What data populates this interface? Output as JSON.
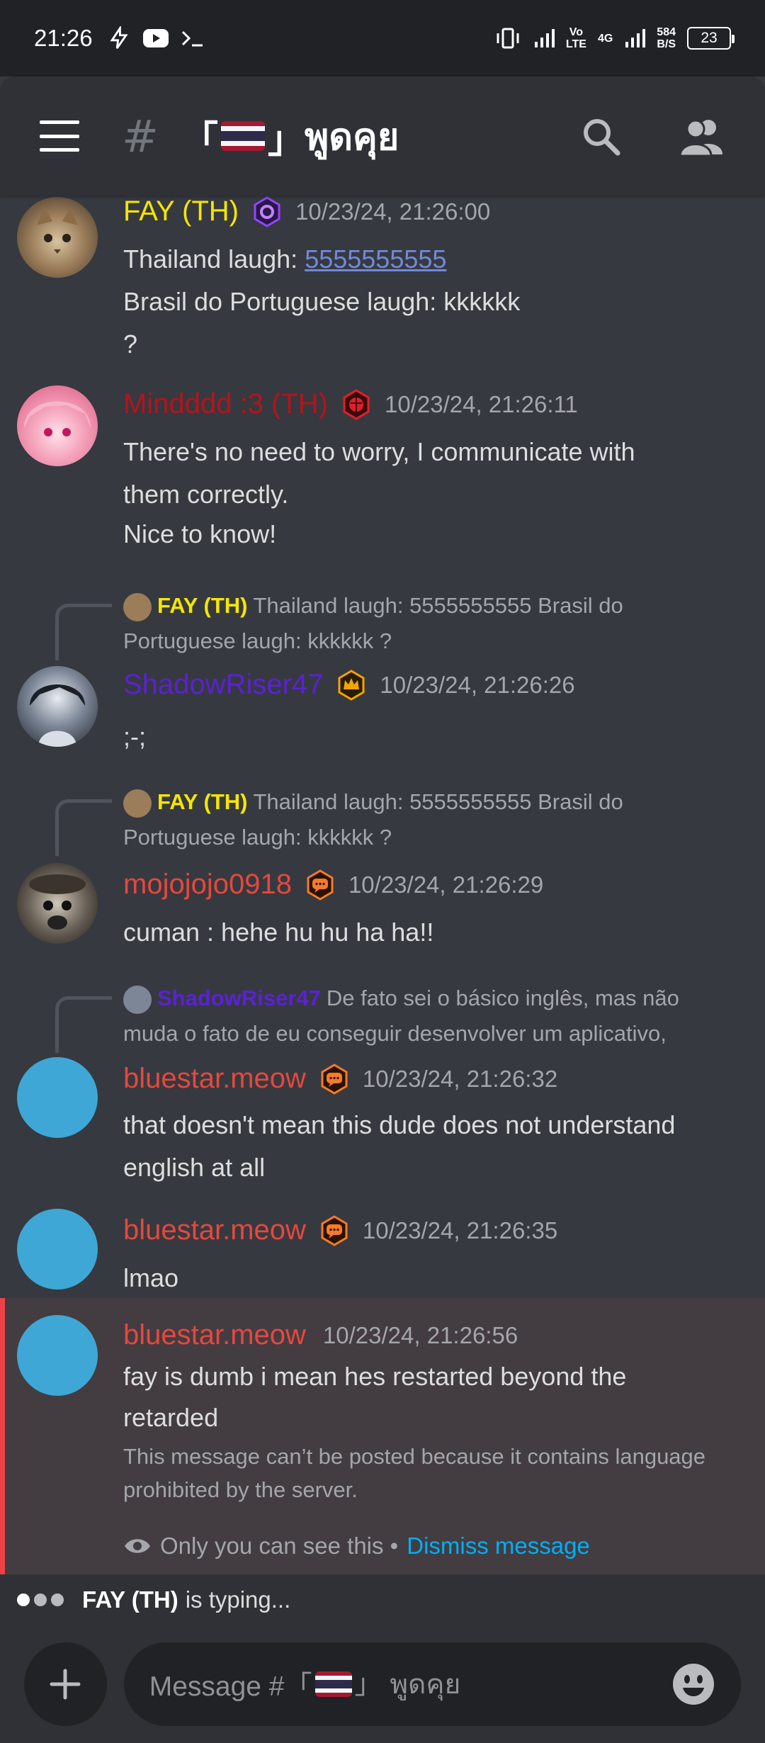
{
  "status_bar": {
    "time": "21:26",
    "net_speed_value": "584",
    "net_speed_unit": "B/S",
    "battery": "23",
    "vo": "Vo",
    "lte": "LTE",
    "4g": "4G"
  },
  "header": {
    "hash": "#",
    "channel_bracket_open": "「",
    "channel_bracket_close": "」",
    "channel_name": "พูดคุย"
  },
  "messages": [
    {
      "username": "FAY (TH)",
      "name_color": "#f5e600",
      "timestamp": "10/23/24, 21:26:00",
      "line1_prefix": "Thailand laugh: ",
      "line1_link": "5555555555",
      "line2": "Brasil do Portuguese laugh: kkkkkk",
      "line3": "?"
    },
    {
      "username": "Mindddd :3 (TH)",
      "name_color": "#b3141c",
      "timestamp": "10/23/24, 21:26:11",
      "line1": "There's no need to worry, I communicate with",
      "line2": "them correctly.",
      "line3": "Nice to know!"
    },
    {
      "reply_name": "FAY (TH)",
      "reply_text": "Thailand laugh: 5555555555 Brasil do",
      "reply_text2": "Portuguese laugh: kkkkkk ?",
      "username": "ShadowRiser47",
      "name_color": "#5b21d6",
      "timestamp": "10/23/24, 21:26:26",
      "line1": ";-;"
    },
    {
      "reply_name": "FAY (TH)",
      "reply_text": "Thailand laugh: 5555555555 Brasil do",
      "reply_text2": "Portuguese laugh: kkkkkk ?",
      "username": "mojojojo0918",
      "name_color": "#e5483e",
      "timestamp": "10/23/24, 21:26:29",
      "line1": "cuman : hehe hu hu ha ha!!"
    },
    {
      "reply_name": "ShadowRiser47",
      "reply_text": "De fato sei o básico inglês, mas não",
      "reply_text2": "muda o fato de eu conseguir desenvolver um aplicativo,",
      "username": "bluestar.meow",
      "name_color": "#e5483e",
      "timestamp": "10/23/24, 21:26:32",
      "line1": "that doesn't mean this dude does not understand",
      "line2": "english at all"
    },
    {
      "username": "bluestar.meow",
      "name_color": "#e5483e",
      "timestamp": "10/23/24, 21:26:35",
      "line1": "lmao"
    },
    {
      "username": "bluestar.meow",
      "name_color": "#e5483e",
      "timestamp": "10/23/24, 21:26:56",
      "line1": "fay is dumb i mean hes restarted beyond the",
      "line2": "retarded",
      "system_line1": "This message can’t be posted because it contains language",
      "system_line2": "prohibited by the server.",
      "ephemeral_text": "Only you can see this •",
      "dismiss_label": "Dismiss message"
    }
  ],
  "typing": {
    "user": "FAY (TH)",
    "text": "is typing..."
  },
  "composer": {
    "placeholder_prefix": "Message #「",
    "placeholder_suffix": "」 พูดคุย"
  },
  "colors": {
    "accent_link": "#00aff4",
    "error_bar": "#ed4245",
    "background": "#36393f"
  }
}
